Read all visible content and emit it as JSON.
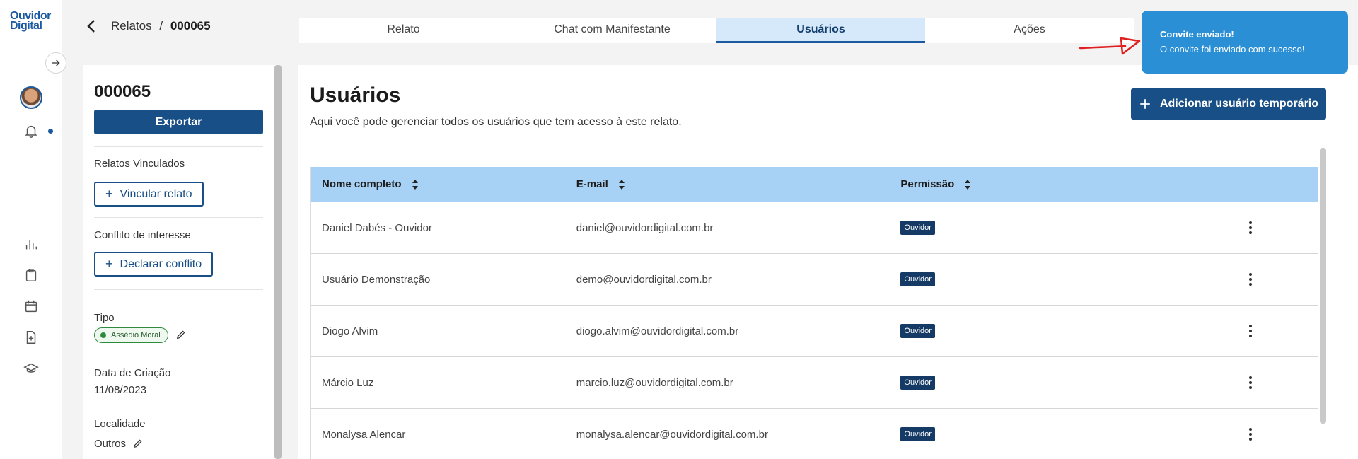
{
  "app": {
    "logo_line1": "Ouvidor",
    "logo_line2": "Digital"
  },
  "breadcrumb": {
    "parent": "Relatos",
    "separator": "/",
    "current": "000065"
  },
  "tabs": [
    {
      "label": "Relato",
      "active": false
    },
    {
      "label": "Chat com Manifestante",
      "active": false
    },
    {
      "label": "Usuários",
      "active": true
    },
    {
      "label": "Ações",
      "active": false
    }
  ],
  "toast": {
    "title": "Convite enviado!",
    "message": "O convite foi enviado com sucesso!"
  },
  "left_panel": {
    "title": "000065",
    "export_label": "Exportar",
    "linked_label": "Relatos Vinculados",
    "link_button": "Vincular relato",
    "conflict_label": "Conflito de interesse",
    "conflict_button": "Declarar conflito",
    "type_label": "Tipo",
    "type_value": "Assédio Moral",
    "created_label": "Data de Criação",
    "created_value": "11/08/2023",
    "location_label": "Localidade",
    "location_value": "Outros"
  },
  "main": {
    "title": "Usuários",
    "subtitle": "Aqui você pode gerenciar todos os usuários que tem acesso à este relato.",
    "add_button": "Adicionar usuário temporário",
    "columns": [
      "Nome completo",
      "E-mail",
      "Permissão"
    ],
    "rows": [
      {
        "name": "Daniel Dabés - Ouvidor",
        "email": "daniel@ouvidordigital.com.br",
        "permission": "Ouvidor"
      },
      {
        "name": "Usuário Demonstração",
        "email": "demo@ouvidordigital.com.br",
        "permission": "Ouvidor"
      },
      {
        "name": "Diogo Alvim",
        "email": "diogo.alvim@ouvidordigital.com.br",
        "permission": "Ouvidor"
      },
      {
        "name": "Márcio Luz",
        "email": "marcio.luz@ouvidordigital.com.br",
        "permission": "Ouvidor"
      },
      {
        "name": "Monalysa Alencar",
        "email": "monalysa.alencar@ouvidordigital.com.br",
        "permission": "Ouvidor"
      }
    ]
  },
  "icons": {
    "rail": [
      "chart-icon",
      "clipboard-icon",
      "calendar-icon",
      "file-add-icon",
      "graduation-cap-icon"
    ]
  },
  "colors": {
    "primary": "#174f86",
    "tab_active_bg": "#d6e9fb",
    "table_header_bg": "#a8d2f5",
    "toast_bg": "#2b8fd6",
    "badge_green": "#2e8b3d"
  }
}
